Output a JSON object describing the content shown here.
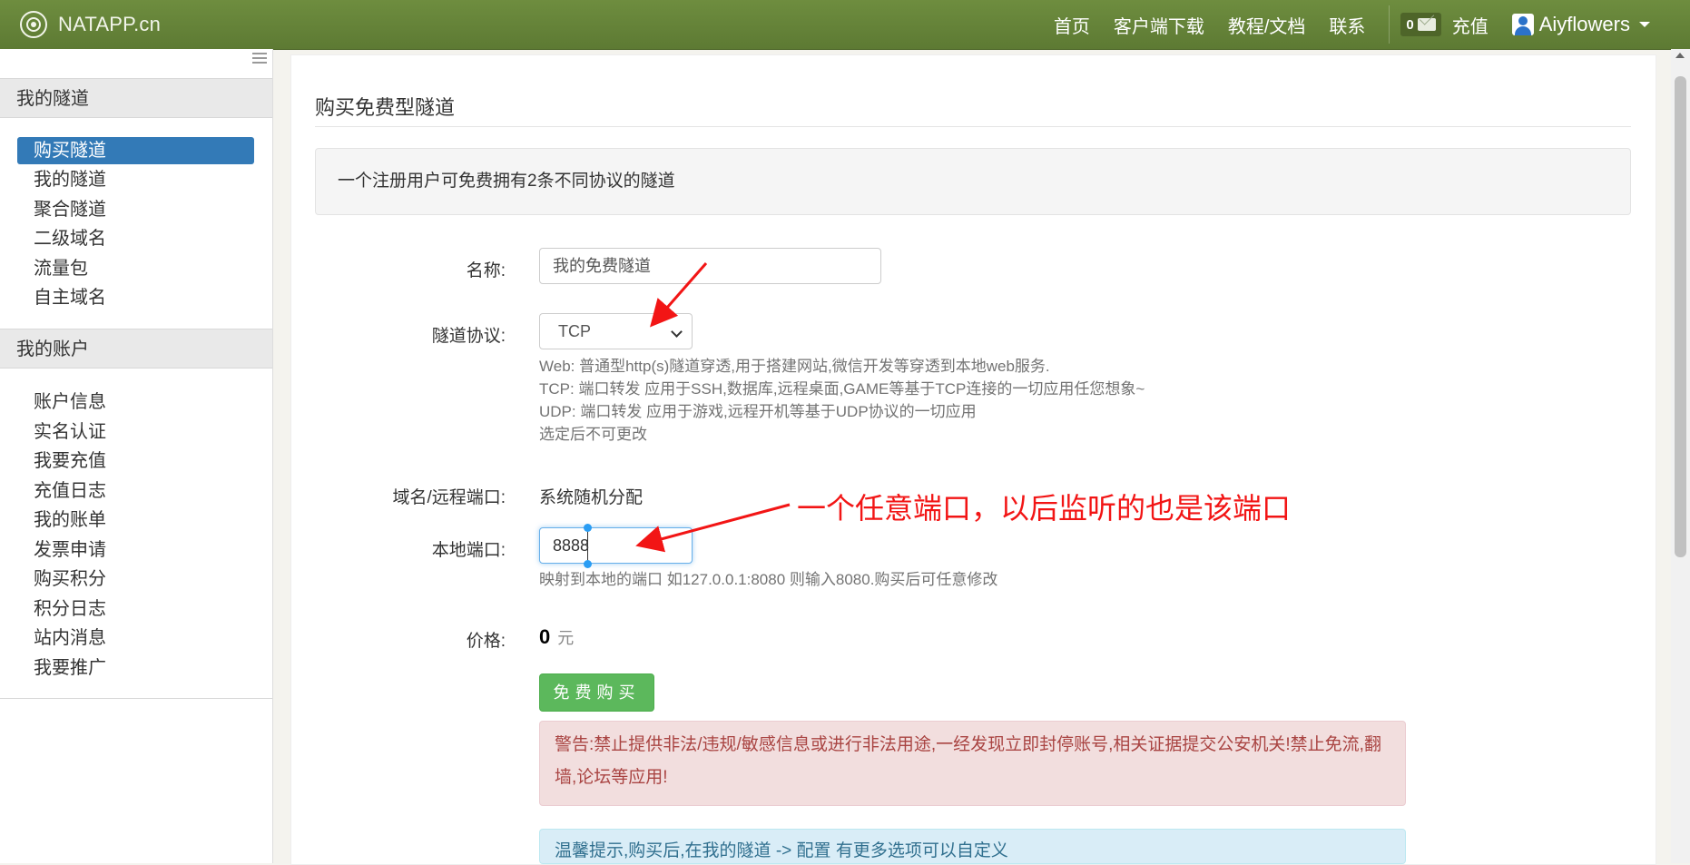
{
  "brand": {
    "name": "NATAPP.cn"
  },
  "nav": {
    "items": [
      "首页",
      "客户端下载",
      "教程/文档",
      "联系"
    ],
    "message_count": "0",
    "recharge": "充值",
    "user": "Aiyflowers"
  },
  "sidebar": {
    "section_tunnels": "我的隧道",
    "tunnel_items": [
      "购买隧道",
      "我的隧道",
      "聚合隧道",
      "二级域名",
      "流量包",
      "自主域名"
    ],
    "section_account": "我的账户",
    "account_items": [
      "账户信息",
      "实名认证",
      "我要充值",
      "充值日志",
      "我的账单",
      "发票申请",
      "购买积分",
      "积分日志",
      "站内消息",
      "我要推广"
    ]
  },
  "main": {
    "title": "购买免费型隧道",
    "notice": "一个注册用户可免费拥有2条不同协议的隧道",
    "form": {
      "name_label": "名称:",
      "name_value": "我的免费隧道",
      "protocol_label": "隧道协议:",
      "protocol_value": "TCP",
      "protocol_help": [
        "Web: 普通型http(s)隧道穿透,用于搭建网站,微信开发等穿透到本地web服务.",
        "TCP: 端口转发 应用于SSH,数据库,远程桌面,GAME等基于TCP连接的一切应用任您想象~",
        "UDP: 端口转发 应用于游戏,远程开机等基于UDP协议的一切应用",
        "选定后不可更改"
      ],
      "domain_label": "域名/远程端口:",
      "domain_value": "系统随机分配",
      "local_port_label": "本地端口:",
      "local_port_value": "8888",
      "local_port_help": "映射到本地的端口 如127.0.0.1:8080 则输入8080.购买后可任意修改",
      "price_label": "价格:",
      "price_value": "0",
      "price_unit": "元",
      "buy_button": "免费购买"
    },
    "warning": "警告:禁止提供非法/违规/敏感信息或进行非法用途,一经发现立即封停账号,相关证据提交公安机关!禁止免流,翻墙,论坛等应用!",
    "tip": "温馨提示,购买后,在我的隧道 -> 配置 有更多选项可以自定义"
  },
  "annotation": {
    "text": "一个任意端口，以后监听的也是该端口",
    "color": "#f21515"
  }
}
